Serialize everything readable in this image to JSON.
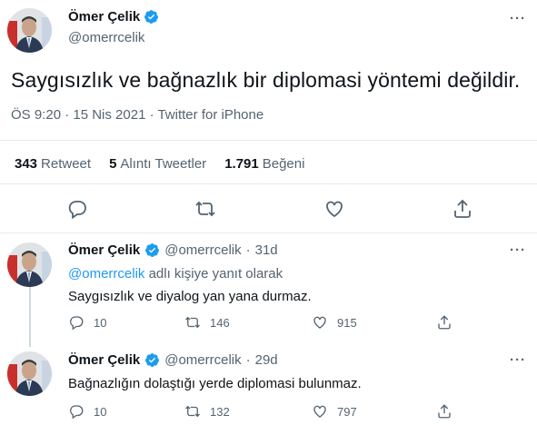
{
  "main_tweet": {
    "author_name": "Ömer Çelik",
    "author_handle": "@omerrcelik",
    "verified_icon": "verified-badge-icon",
    "text": "Saygısızlık ve bağnazlık bir diplomasi yöntemi değildir.",
    "meta": "ÖS 9:20 · 15 Nis 2021 · Twitter for iPhone",
    "stats": {
      "retweets_count": "343",
      "retweets_label": "Retweet",
      "quotes_count": "5",
      "quotes_label": "Alıntı Tweetler",
      "likes_count": "1.791",
      "likes_label": "Beğeni"
    },
    "actions": [
      "reply-icon",
      "retweet-icon",
      "like-icon",
      "share-icon"
    ],
    "more_label": "···"
  },
  "replies": [
    {
      "author_name": "Ömer Çelik",
      "verified_icon": "verified-badge-icon",
      "author_handle": "@omerrcelik",
      "dot": "·",
      "time": "31d",
      "context_link": "@omerrcelik",
      "context_rest": "adlı kişiye yanıt olarak",
      "text": "Saygısızlık ve diyalog yan yana durmaz.",
      "reply_count": "10",
      "retweet_count": "146",
      "like_count": "915",
      "more_label": "···"
    },
    {
      "author_name": "Ömer Çelik",
      "verified_icon": "verified-badge-icon",
      "author_handle": "@omerrcelik",
      "dot": "·",
      "time": "29d",
      "text": "Bağnazlığın dolaştığı yerde diplomasi bulunmaz.",
      "reply_count": "10",
      "retweet_count": "132",
      "like_count": "797",
      "more_label": "···"
    }
  ],
  "colors": {
    "accent": "#1d9bf0",
    "text": "#0f1419",
    "secondary": "#536471",
    "divider": "#e6ecf0"
  }
}
